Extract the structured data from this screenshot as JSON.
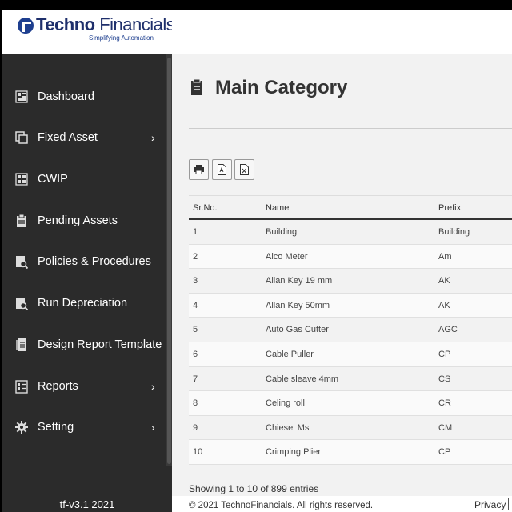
{
  "brand": {
    "name_bold": "Techno",
    "name_light": " Financials",
    "tagline": "Simplifying Automation",
    "primary_color": "#1e2f6b"
  },
  "sidebar": {
    "items": [
      {
        "label": "Dashboard",
        "icon": "dashboard-icon",
        "has_submenu": false
      },
      {
        "label": "Fixed Asset",
        "icon": "fixed-asset-icon",
        "has_submenu": true
      },
      {
        "label": "CWIP",
        "icon": "cwip-icon",
        "has_submenu": false
      },
      {
        "label": "Pending Assets",
        "icon": "pending-assets-icon",
        "has_submenu": false
      },
      {
        "label": "Policies & Procedures",
        "icon": "policies-icon",
        "has_submenu": false
      },
      {
        "label": "Run Depreciation",
        "icon": "run-depreciation-icon",
        "has_submenu": false
      },
      {
        "label": "Design Report Template",
        "icon": "report-template-icon",
        "has_submenu": false
      },
      {
        "label": "Reports",
        "icon": "reports-icon",
        "has_submenu": true
      },
      {
        "label": "Setting",
        "icon": "gear-icon",
        "has_submenu": true
      }
    ],
    "chevron": "›",
    "version": "tf-v3.1 2021",
    "background": "#2b2b2b"
  },
  "main": {
    "title": "Main Category",
    "toolbar": [
      "print-icon",
      "pdf-icon",
      "excel-icon"
    ],
    "table": {
      "headers": [
        "Sr.No.",
        "Name",
        "Prefix"
      ],
      "rows": [
        [
          "1",
          "Building",
          "Building"
        ],
        [
          "2",
          "Alco Meter",
          "Am"
        ],
        [
          "3",
          "Allan Key 19 mm",
          "AK"
        ],
        [
          "4",
          "Allan Key 50mm",
          "AK"
        ],
        [
          "5",
          "Auto Gas Cutter",
          "AGC"
        ],
        [
          "6",
          "Cable Puller",
          "CP"
        ],
        [
          "7",
          "Cable sleave 4mm",
          "CS"
        ],
        [
          "8",
          "Celing roll",
          "CR"
        ],
        [
          "9",
          "Chiesel Ms",
          "CM"
        ],
        [
          "10",
          "Crimping Plier",
          "CP"
        ]
      ]
    },
    "entries_text": "Showing 1 to 10 of 899 entries"
  },
  "footer": {
    "copyright": "© 2021 TechnoFinancials. All rights reserved.",
    "privacy": "Privacy"
  }
}
